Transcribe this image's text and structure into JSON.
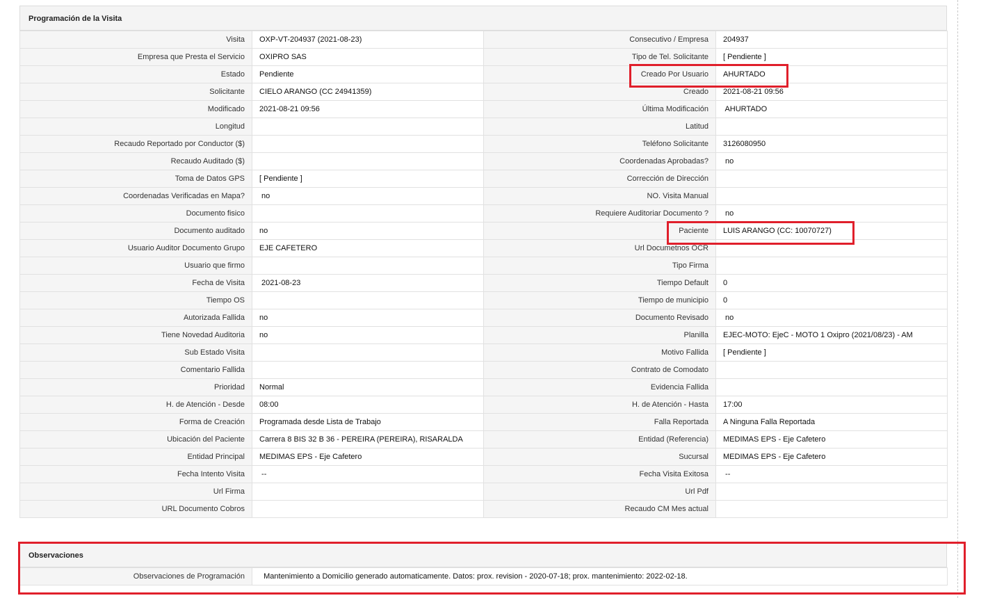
{
  "programacion": {
    "title": "Programación de la Visita",
    "rows": [
      [
        "Visita",
        "OXP-VT-204937 (2021-08-23)",
        "Consecutivo / Empresa",
        "204937"
      ],
      [
        "Empresa que Presta el Servicio",
        "OXIPRO SAS",
        "Tipo de Tel. Solicitante",
        "[ Pendiente ]"
      ],
      [
        "Estado",
        "Pendiente",
        "Creado Por Usuario",
        "AHURTADO"
      ],
      [
        "Solicitante",
        "CIELO ARANGO (CC 24941359)",
        "Creado",
        "2021-08-21 09:56"
      ],
      [
        "Modificado",
        "2021-08-21 09:56",
        "Última Modificación",
        " AHURTADO"
      ],
      [
        "Longitud",
        "",
        "Latitud",
        ""
      ],
      [
        "Recaudo Reportado por Conductor ($)",
        "",
        "Teléfono Solicitante",
        "3126080950"
      ],
      [
        "Recaudo Auditado ($)",
        "",
        "Coordenadas Aprobadas?",
        " no"
      ],
      [
        "Toma de Datos GPS",
        "[ Pendiente ]",
        "Corrección de Dirección",
        ""
      ],
      [
        "Coordenadas Verificadas en Mapa?",
        " no",
        "NO. Visita Manual",
        ""
      ],
      [
        "Documento fisico",
        "",
        "Requiere Auditoriar Documento ?",
        " no"
      ],
      [
        "Documento auditado",
        "no",
        "Paciente",
        "LUIS ARANGO (CC: 10070727)"
      ],
      [
        "Usuario Auditor Documento Grupo",
        "EJE CAFETERO",
        "Url Documetnos OCR",
        ""
      ],
      [
        "Usuario que firmo",
        "",
        "Tipo Firma",
        ""
      ],
      [
        "Fecha de Visita",
        " 2021-08-23",
        "Tiempo Default",
        "0"
      ],
      [
        "Tiempo OS",
        "",
        "Tiempo de municipio",
        "0"
      ],
      [
        "Autorizada Fallida",
        "no",
        "Documento Revisado",
        " no"
      ],
      [
        "Tiene Novedad Auditoria",
        "no",
        "Planilla",
        "EJEC-MOTO: EjeC - MOTO 1 Oxipro (2021/08/23) - AM"
      ],
      [
        "Sub Estado Visita",
        "",
        "Motivo Fallida",
        "[ Pendiente ]"
      ],
      [
        "Comentario Fallida",
        "",
        "Contrato de Comodato",
        ""
      ],
      [
        "Prioridad",
        "Normal",
        "Evidencia Fallida",
        ""
      ],
      [
        "H. de Atención - Desde",
        "08:00",
        "H. de Atención - Hasta",
        "17:00"
      ],
      [
        "Forma de Creación",
        "Programada desde Lista de Trabajo",
        "Falla Reportada",
        "A Ninguna Falla Reportada"
      ],
      [
        "Ubicación del Paciente",
        "Carrera 8 BIS 32 B 36 - PEREIRA (PEREIRA), RISARALDA",
        "Entidad (Referencia)",
        "MEDIMAS EPS - Eje Cafetero"
      ],
      [
        "Entidad Principal",
        "MEDIMAS EPS - Eje Cafetero",
        "Sucursal",
        "MEDIMAS EPS - Eje Cafetero"
      ],
      [
        "Fecha Intento Visita",
        " --",
        "Fecha Visita Exitosa",
        " --"
      ],
      [
        "Url Firma",
        "",
        "Url Pdf",
        ""
      ],
      [
        "URL Documento Cobros",
        "",
        "Recaudo CM Mes actual",
        ""
      ]
    ]
  },
  "observaciones": {
    "title": "Observaciones",
    "label": "Observaciones de Programación",
    "value": "  Mantenimiento a Domicilio generado automaticamente. Datos: prox. revision - 2020-07-18; prox. mantenimiento: 2022-02-18."
  },
  "colors": {
    "highlight": "#e01f2b",
    "label_bg": "#f5f5f5",
    "header_bg": "#f4f4f4"
  }
}
